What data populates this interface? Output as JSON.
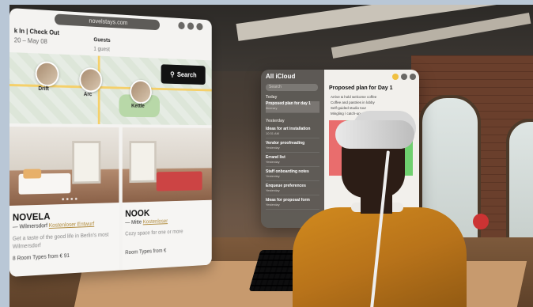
{
  "browser": {
    "url": "novelstays.com",
    "checkin_label": "k In | Check Out",
    "dates": "20 – May 08",
    "guests_label": "Guests",
    "guests_value": "1 guest",
    "search_label": "Search",
    "map_pins": [
      {
        "label": "Drift"
      },
      {
        "label": "Arc"
      },
      {
        "label": "Kettle"
      }
    ],
    "cards": [
      {
        "title": "NOVELA",
        "sub_prefix": "— Wilmersdorf",
        "sub_link": "Kostenloser Entwurf",
        "description": "Get a taste of the good life in Berlin's most Wilmersdorf",
        "rooms": "8 Room Types from € 91"
      },
      {
        "title": "NOOK",
        "sub_prefix": "— Mitte",
        "sub_link": "Kostenloser",
        "description": "Cozy space for one or more",
        "rooms": "Room Types from €"
      }
    ]
  },
  "notes": {
    "title": "All iCloud",
    "search_placeholder": "Search",
    "section_today": "Today",
    "section_yesterday": "Yesterday",
    "items": [
      {
        "title": "Proposed plan for day 1",
        "meta": "Itinerary"
      },
      {
        "title": "Ideas for art installation",
        "meta": "10:31 AM"
      },
      {
        "title": "Vendor proofreading",
        "meta": "Yesterday"
      },
      {
        "title": "Errand list",
        "meta": "Yesterday"
      },
      {
        "title": "Staff onboarding notes",
        "meta": "Yesterday"
      },
      {
        "title": "Enqueue preferences",
        "meta": "Yesterday"
      },
      {
        "title": "Ideas for proposal form",
        "meta": "Yesterday"
      }
    ],
    "note_heading": "Proposed plan for Day 1",
    "note_lines": [
      "Arrive & hold welcome coffee",
      "Coffee and pastries in lobby",
      "Self-guided studio tour",
      "Mingling / catch-up session"
    ]
  },
  "colors": {
    "accent_black": "#121212",
    "link_gold": "#b08a3a",
    "sweater": "#c27d1c"
  }
}
